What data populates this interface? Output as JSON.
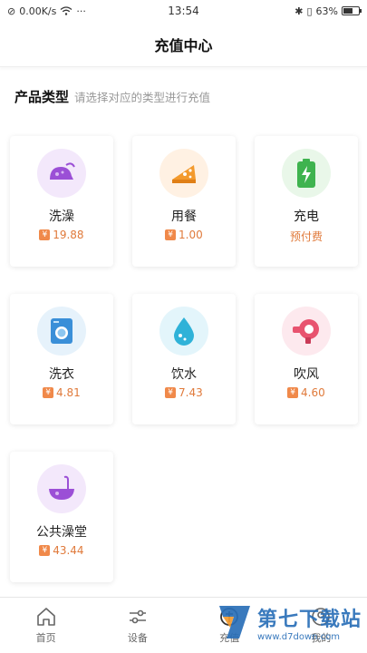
{
  "status": {
    "speed": "0.00K/s",
    "time": "13:54",
    "battery_text": "63%",
    "battery_level": 0.63
  },
  "header": {
    "title": "充值中心"
  },
  "section": {
    "title": "产品类型",
    "hint": "请选择对应的类型进行充值"
  },
  "currency_symbol": "¥",
  "products": [
    {
      "name": "洗澡",
      "price": "19.88",
      "icon": "shower-icon",
      "bg": "#f3e8fb",
      "color": "#a05ad8"
    },
    {
      "name": "用餐",
      "price": "1.00",
      "icon": "meal-icon",
      "bg": "#fff1e3",
      "color": "#f39a2d"
    },
    {
      "name": "充电",
      "price": "预付费",
      "icon": "battery-charge-icon",
      "bg": "#e9f7e9",
      "color": "#3fb34f"
    },
    {
      "name": "洗衣",
      "price": "4.81",
      "icon": "washing-machine-icon",
      "bg": "#e6f2fb",
      "color": "#3a8fd8"
    },
    {
      "name": "饮水",
      "price": "7.43",
      "icon": "water-drop-icon",
      "bg": "#e3f5fb",
      "color": "#2fb2d8"
    },
    {
      "name": "吹风",
      "price": "4.60",
      "icon": "hair-dryer-icon",
      "bg": "#fde9ee",
      "color": "#e8536f"
    },
    {
      "name": "公共澡堂",
      "price": "43.44",
      "icon": "bathhouse-icon",
      "bg": "#f3e8fb",
      "color": "#a05ad8"
    }
  ],
  "tabs": [
    {
      "label": "首页",
      "icon": "home-icon"
    },
    {
      "label": "设备",
      "icon": "sliders-icon"
    },
    {
      "label": "充值",
      "icon": "recharge-icon"
    },
    {
      "label": "我的",
      "icon": "user-icon"
    }
  ],
  "watermark": {
    "big": "第七下载站",
    "small": "www.d7down.com"
  }
}
